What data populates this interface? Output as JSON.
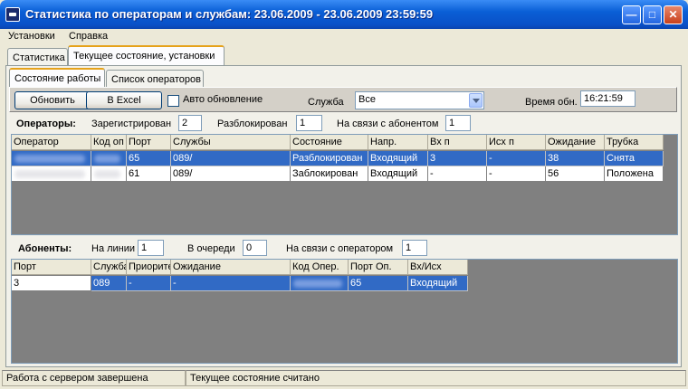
{
  "window": {
    "title": "Статистика по операторам и службам: 23.06.2009 - 23.06.2009 23:59:59"
  },
  "menu": [
    "Установки",
    "Справка"
  ],
  "main_tabs": [
    "Статистика",
    "Текущее состояние, установки"
  ],
  "sub_tabs": [
    "Состояние работы",
    "Список операторов"
  ],
  "toolbar": {
    "refresh": "Обновить",
    "excel": "В Excel",
    "auto_refresh": "Авто обновление",
    "service_label": "Служба",
    "service_value": "Все",
    "time_label": "Время обн.",
    "time_value": "16:21:59"
  },
  "operators": {
    "title": "Операторы:",
    "registered_label": "Зарегистрирован",
    "registered_value": "2",
    "unblocked_label": "Разблокирован",
    "unblocked_value": "1",
    "on_call_label": "На связи с абонентом",
    "on_call_value": "1",
    "columns": [
      "Оператор",
      "Код оп",
      "Порт",
      "Службы",
      "Состояние",
      "Напр.",
      "Вх п",
      "Исх п",
      "Ожидание",
      "Трубка"
    ],
    "rows": [
      [
        "",
        "",
        "65",
        "089/",
        "Разблокирован",
        "Входящий",
        "3",
        "-",
        "38",
        "Снята"
      ],
      [
        "",
        "",
        "61",
        "089/",
        "Заблокирован",
        "Входящий",
        "-",
        "-",
        "56",
        "Положена"
      ]
    ]
  },
  "subscribers": {
    "title": "Абоненты:",
    "on_line_label": "На линии",
    "on_line_value": "1",
    "queue_label": "В очереди",
    "queue_value": "0",
    "with_operator_label": "На связи с оператором",
    "with_operator_value": "1",
    "columns": [
      "Порт",
      "Служба",
      "Приорите",
      "Ожидание",
      "Код Опер.",
      "Порт Оп.",
      "Вх/Исх"
    ],
    "rows": [
      [
        "3",
        "089",
        "-",
        "-",
        "",
        "65",
        "Входящий"
      ]
    ]
  },
  "statusbar": [
    "Работа с сервером завершена",
    "Текущее состояние считано"
  ]
}
